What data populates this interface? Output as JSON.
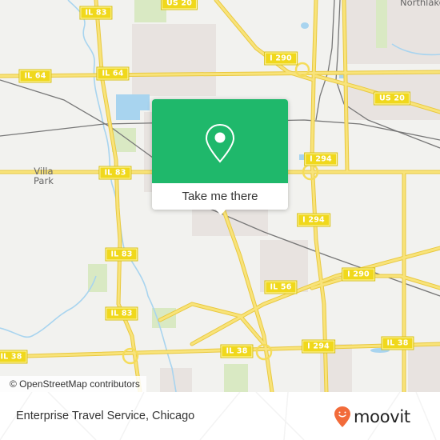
{
  "map": {
    "place_labels": [
      {
        "id": "villa-park",
        "text": "Villa\nPark"
      },
      {
        "id": "northlake",
        "text": "Northlake"
      }
    ],
    "road_shields": [
      {
        "id": "il83-top",
        "text": "IL 83"
      },
      {
        "id": "us20-top",
        "text": "US 20"
      },
      {
        "id": "il64-left",
        "text": "IL 64"
      },
      {
        "id": "il64-mid",
        "text": "IL 64"
      },
      {
        "id": "i290-top",
        "text": "I 290"
      },
      {
        "id": "us20-right",
        "text": "US 20"
      },
      {
        "id": "il83-mid",
        "text": "IL 83"
      },
      {
        "id": "i294-upper",
        "text": "I 294"
      },
      {
        "id": "i294-mid",
        "text": "I 294"
      },
      {
        "id": "il83-lower",
        "text": "IL 83"
      },
      {
        "id": "i290-right",
        "text": "I 290"
      },
      {
        "id": "il56",
        "text": "IL 56"
      },
      {
        "id": "il83-bottom",
        "text": "IL 83"
      },
      {
        "id": "il38-left",
        "text": "IL 38"
      },
      {
        "id": "il38-mid",
        "text": "IL 38"
      },
      {
        "id": "i294-bottom",
        "text": "I 294"
      },
      {
        "id": "il38-right",
        "text": "IL 38"
      }
    ],
    "attribution": "© OpenStreetMap contributors",
    "colors": {
      "land": "#f2f2ef",
      "road": "#f5dc5a",
      "water": "#a8d4ef",
      "park": "#d9e9c3",
      "urban": "#e8e3e0",
      "rail": "#777777"
    }
  },
  "popup": {
    "icon": "map-pin-icon",
    "button_label": "Take me there",
    "accent_color": "#1fb86b"
  },
  "footer": {
    "place_title": "Enterprise Travel Service, Chicago",
    "brand": "moovit",
    "brand_color": "#f26b3a"
  }
}
